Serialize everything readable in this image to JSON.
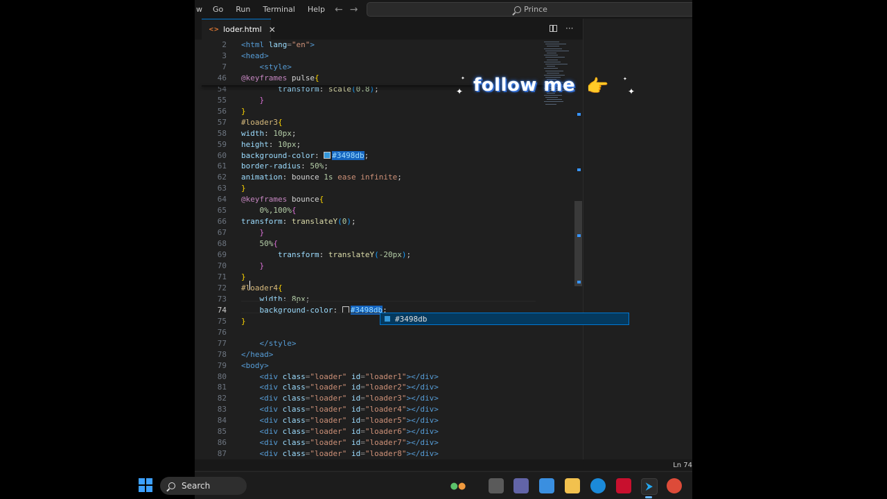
{
  "menu": {
    "items": [
      "Go",
      "Run",
      "Terminal",
      "Help"
    ],
    "first_partial": "w"
  },
  "nav": {
    "back": "←",
    "forward": "→"
  },
  "command_center": {
    "label": "Prince"
  },
  "tab": {
    "icon": "<>",
    "name": "loder.html",
    "close": "✕"
  },
  "tab_actions": {
    "more": "···"
  },
  "suggestion": {
    "text": "#3498db"
  },
  "status": {
    "ln": "Ln 74"
  },
  "taskbar": {
    "search_label": "Search"
  },
  "overlay": {
    "text": "follow me",
    "emoji": "👉"
  },
  "colors": {
    "accent": "#0078d4",
    "swatch": "#3498db"
  },
  "editor": {
    "lines": [
      {
        "n": "2",
        "segs": [
          [
            "t-tag",
            "<html "
          ],
          [
            "t-attr",
            "lang"
          ],
          [
            "t-pun",
            "="
          ],
          [
            "t-str",
            "\"en\""
          ],
          [
            "t-tag",
            ">"
          ]
        ]
      },
      {
        "n": "3",
        "segs": [
          [
            "t-tag",
            "<head>"
          ]
        ]
      },
      {
        "n": "7",
        "segs": [
          [
            "",
            "    "
          ],
          [
            "t-tag",
            "<style>"
          ]
        ]
      },
      {
        "n": "46",
        "segs": [
          [
            "t-kw",
            "@keyframes "
          ],
          [
            "",
            "pulse"
          ],
          [
            "t-b1",
            "{"
          ]
        ]
      },
      {
        "n": "54",
        "segs": [
          [
            "",
            "        "
          ],
          [
            "t-prop",
            "transform"
          ],
          [
            "",
            ": "
          ],
          [
            "t-fn",
            "scale"
          ],
          [
            "t-b3",
            "("
          ],
          [
            "t-num",
            "0.8"
          ],
          [
            "t-b3",
            ")"
          ],
          [
            "",
            ";"
          ]
        ]
      },
      {
        "n": "55",
        "segs": [
          [
            "",
            "    "
          ],
          [
            "t-b2",
            "}"
          ]
        ]
      },
      {
        "n": "56",
        "segs": [
          [
            "t-b1",
            "}"
          ]
        ]
      },
      {
        "n": "57",
        "segs": [
          [
            "t-sel",
            "#loader3"
          ],
          [
            "t-b1",
            "{"
          ]
        ]
      },
      {
        "n": "58",
        "segs": [
          [
            "t-prop",
            "width"
          ],
          [
            "",
            ": "
          ],
          [
            "t-num",
            "10px"
          ],
          [
            "",
            ";"
          ]
        ]
      },
      {
        "n": "59",
        "segs": [
          [
            "t-prop",
            "height"
          ],
          [
            "",
            ": "
          ],
          [
            "t-num",
            "10px"
          ],
          [
            "",
            ";"
          ]
        ]
      },
      {
        "n": "60",
        "segs": [
          [
            "t-prop",
            "background-color"
          ],
          [
            "",
            ": "
          ],
          [
            "swatch",
            ""
          ],
          [
            "hl",
            "#3498db"
          ],
          [
            "",
            ";"
          ]
        ]
      },
      {
        "n": "61",
        "segs": [
          [
            "t-prop",
            "border-radius"
          ],
          [
            "",
            ": "
          ],
          [
            "t-num",
            "50%"
          ],
          [
            "",
            ";"
          ]
        ]
      },
      {
        "n": "62",
        "segs": [
          [
            "t-prop",
            "animation"
          ],
          [
            "",
            ": bounce "
          ],
          [
            "t-num",
            "1s"
          ],
          [
            "t-str",
            " ease"
          ],
          [
            "t-str",
            " infinite"
          ],
          [
            "",
            ";"
          ]
        ]
      },
      {
        "n": "63",
        "segs": [
          [
            "t-b1",
            "}"
          ]
        ]
      },
      {
        "n": "64",
        "segs": [
          [
            "t-kw",
            "@keyframes "
          ],
          [
            "",
            "bounce"
          ],
          [
            "t-b1",
            "{"
          ]
        ]
      },
      {
        "n": "65",
        "segs": [
          [
            "",
            "    "
          ],
          [
            "t-num",
            "0%,100%"
          ],
          [
            "t-b2",
            "{"
          ]
        ]
      },
      {
        "n": "66",
        "segs": [
          [
            "t-prop",
            "transform"
          ],
          [
            "",
            ": "
          ],
          [
            "t-fn",
            "translateY"
          ],
          [
            "t-b3",
            "("
          ],
          [
            "t-num",
            "0"
          ],
          [
            "t-b3",
            ")"
          ],
          [
            "",
            ";"
          ]
        ]
      },
      {
        "n": "67",
        "segs": [
          [
            "",
            "    "
          ],
          [
            "t-b2",
            "}"
          ]
        ]
      },
      {
        "n": "68",
        "segs": [
          [
            "",
            "    "
          ],
          [
            "t-num",
            "50%"
          ],
          [
            "t-b2",
            "{"
          ]
        ]
      },
      {
        "n": "69",
        "segs": [
          [
            "",
            "        "
          ],
          [
            "t-prop",
            "transform"
          ],
          [
            "",
            ": "
          ],
          [
            "t-fn",
            "translateY"
          ],
          [
            "t-b3",
            "("
          ],
          [
            "t-num",
            "-20px"
          ],
          [
            "t-b3",
            ")"
          ],
          [
            "",
            ";"
          ]
        ]
      },
      {
        "n": "70",
        "segs": [
          [
            "",
            "    "
          ],
          [
            "t-b2",
            "}"
          ]
        ]
      },
      {
        "n": "71",
        "segs": [
          [
            "t-b1",
            "}"
          ]
        ]
      },
      {
        "n": "72",
        "segs": [
          [
            "t-sel",
            "#loader4"
          ],
          [
            "t-b1",
            "{"
          ]
        ]
      },
      {
        "n": "73",
        "segs": [
          [
            "",
            "    "
          ],
          [
            "t-prop",
            "width"
          ],
          [
            "",
            ": "
          ],
          [
            "t-num",
            "8px"
          ],
          [
            "",
            ";"
          ]
        ]
      },
      {
        "n": "74",
        "segs": [
          [
            "",
            "    "
          ],
          [
            "t-prop",
            "background-color"
          ],
          [
            "",
            ": "
          ],
          [
            "swatch-empty",
            ""
          ],
          [
            "hl",
            "#3498db"
          ],
          [
            "",
            ";"
          ]
        ]
      },
      {
        "n": "75",
        "segs": [
          [
            "t-b1",
            "}"
          ]
        ]
      },
      {
        "n": "76",
        "segs": []
      },
      {
        "n": "77",
        "segs": [
          [
            "",
            "    "
          ],
          [
            "t-tag",
            "</style>"
          ]
        ]
      },
      {
        "n": "78",
        "segs": [
          [
            "t-tag",
            "</head>"
          ]
        ]
      },
      {
        "n": "79",
        "segs": [
          [
            "t-tag",
            "<body>"
          ]
        ]
      },
      {
        "n": "80",
        "segs": [
          [
            "",
            "    "
          ],
          [
            "t-tag",
            "<div "
          ],
          [
            "t-attr",
            "class"
          ],
          [
            "t-pun",
            "="
          ],
          [
            "t-str",
            "\"loader\""
          ],
          [
            "t-attr",
            " id"
          ],
          [
            "t-pun",
            "="
          ],
          [
            "t-str",
            "\"loader1\""
          ],
          [
            "t-tag",
            "></div>"
          ]
        ]
      },
      {
        "n": "81",
        "segs": [
          [
            "",
            "    "
          ],
          [
            "t-tag",
            "<div "
          ],
          [
            "t-attr",
            "class"
          ],
          [
            "t-pun",
            "="
          ],
          [
            "t-str",
            "\"loader\""
          ],
          [
            "t-attr",
            " id"
          ],
          [
            "t-pun",
            "="
          ],
          [
            "t-str",
            "\"loader2\""
          ],
          [
            "t-tag",
            "></div>"
          ]
        ]
      },
      {
        "n": "82",
        "segs": [
          [
            "",
            "    "
          ],
          [
            "t-tag",
            "<div "
          ],
          [
            "t-attr",
            "class"
          ],
          [
            "t-pun",
            "="
          ],
          [
            "t-str",
            "\"loader\""
          ],
          [
            "t-attr",
            " id"
          ],
          [
            "t-pun",
            "="
          ],
          [
            "t-str",
            "\"loader3\""
          ],
          [
            "t-tag",
            "></div>"
          ]
        ]
      },
      {
        "n": "83",
        "segs": [
          [
            "",
            "    "
          ],
          [
            "t-tag",
            "<div "
          ],
          [
            "t-attr",
            "class"
          ],
          [
            "t-pun",
            "="
          ],
          [
            "t-str",
            "\"loader\""
          ],
          [
            "t-attr",
            " id"
          ],
          [
            "t-pun",
            "="
          ],
          [
            "t-str",
            "\"loader4\""
          ],
          [
            "t-tag",
            "></div>"
          ]
        ]
      },
      {
        "n": "84",
        "segs": [
          [
            "",
            "    "
          ],
          [
            "t-tag",
            "<div "
          ],
          [
            "t-attr",
            "class"
          ],
          [
            "t-pun",
            "="
          ],
          [
            "t-str",
            "\"loader\""
          ],
          [
            "t-attr",
            " id"
          ],
          [
            "t-pun",
            "="
          ],
          [
            "t-str",
            "\"loader5\""
          ],
          [
            "t-tag",
            "></div>"
          ]
        ]
      },
      {
        "n": "85",
        "segs": [
          [
            "",
            "    "
          ],
          [
            "t-tag",
            "<div "
          ],
          [
            "t-attr",
            "class"
          ],
          [
            "t-pun",
            "="
          ],
          [
            "t-str",
            "\"loader\""
          ],
          [
            "t-attr",
            " id"
          ],
          [
            "t-pun",
            "="
          ],
          [
            "t-str",
            "\"loader6\""
          ],
          [
            "t-tag",
            "></div>"
          ]
        ]
      },
      {
        "n": "86",
        "segs": [
          [
            "",
            "    "
          ],
          [
            "t-tag",
            "<div "
          ],
          [
            "t-attr",
            "class"
          ],
          [
            "t-pun",
            "="
          ],
          [
            "t-str",
            "\"loader\""
          ],
          [
            "t-attr",
            " id"
          ],
          [
            "t-pun",
            "="
          ],
          [
            "t-str",
            "\"loader7\""
          ],
          [
            "t-tag",
            "></div>"
          ]
        ]
      },
      {
        "n": "87",
        "segs": [
          [
            "",
            "    "
          ],
          [
            "t-tag",
            "<div "
          ],
          [
            "t-attr",
            "class"
          ],
          [
            "t-pun",
            "="
          ],
          [
            "t-str",
            "\"loader\""
          ],
          [
            "t-attr",
            " id"
          ],
          [
            "t-pun",
            "="
          ],
          [
            "t-str",
            "\"loader8\""
          ],
          [
            "t-tag",
            "></div>"
          ]
        ]
      }
    ],
    "active_line": "74"
  }
}
